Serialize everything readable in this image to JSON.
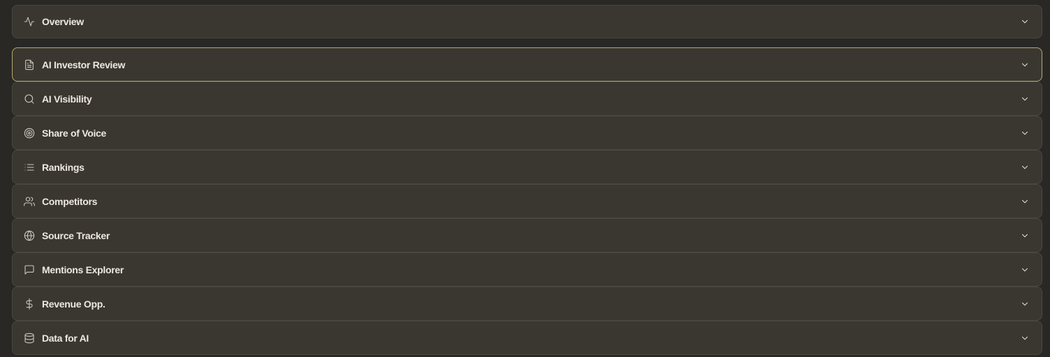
{
  "sections": [
    {
      "label": "Overview",
      "icon": "activity-icon",
      "expanded": false
    },
    {
      "label": "AI Investor Review",
      "icon": "document-icon",
      "expanded": false,
      "focused": true
    },
    {
      "label": "AI Visibility",
      "icon": "search-icon",
      "expanded": false
    },
    {
      "label": "Share of Voice",
      "icon": "target-icon",
      "expanded": false
    },
    {
      "label": "Rankings",
      "icon": "list-icon",
      "expanded": false
    },
    {
      "label": "Competitors",
      "icon": "users-icon",
      "expanded": false
    },
    {
      "label": "Source Tracker",
      "icon": "globe-icon",
      "expanded": false
    },
    {
      "label": "Mentions Explorer",
      "icon": "message-square-icon",
      "expanded": false
    },
    {
      "label": "Revenue Opp.",
      "icon": "dollar-sign-icon",
      "expanded": false
    },
    {
      "label": "Data for AI",
      "icon": "database-icon",
      "expanded": false
    }
  ],
  "colors": {
    "background": "#2a2825",
    "panel": "#3a3731",
    "panel_border": "#4a4740",
    "focus_border": "#b3aa6e",
    "text": "#ece8df"
  }
}
